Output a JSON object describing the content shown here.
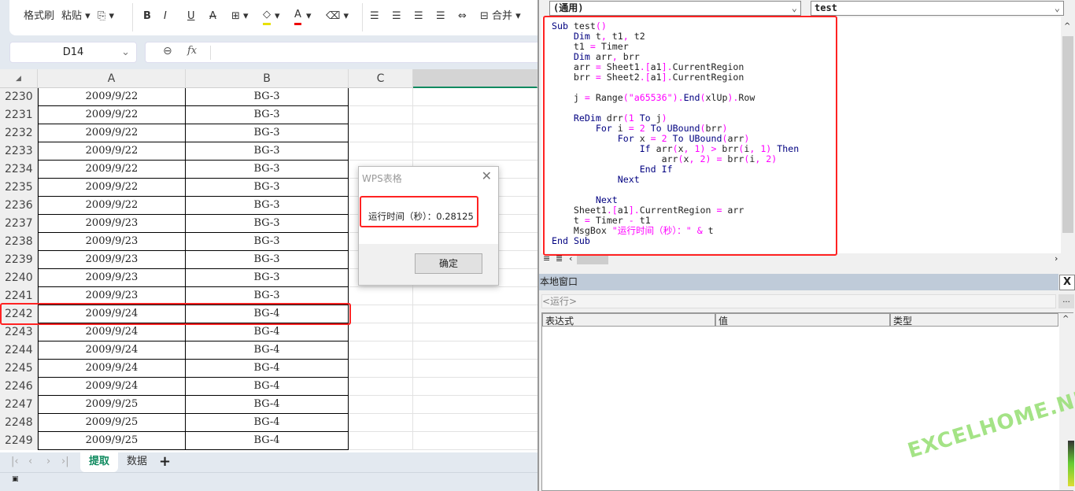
{
  "ribbon": {
    "format_painter": "格式刷",
    "paste": "粘贴",
    "merge": "合并"
  },
  "formula_bar": {
    "name_box": "D14",
    "fx": "fx",
    "value": ""
  },
  "columns": [
    "A",
    "B",
    "C"
  ],
  "rows": [
    {
      "n": "2230",
      "a": "2009/9/22",
      "b": "BG-3"
    },
    {
      "n": "2231",
      "a": "2009/9/22",
      "b": "BG-3"
    },
    {
      "n": "2232",
      "a": "2009/9/22",
      "b": "BG-3"
    },
    {
      "n": "2233",
      "a": "2009/9/22",
      "b": "BG-3"
    },
    {
      "n": "2234",
      "a": "2009/9/22",
      "b": "BG-3"
    },
    {
      "n": "2235",
      "a": "2009/9/22",
      "b": "BG-3"
    },
    {
      "n": "2236",
      "a": "2009/9/22",
      "b": "BG-3"
    },
    {
      "n": "2237",
      "a": "2009/9/23",
      "b": "BG-3"
    },
    {
      "n": "2238",
      "a": "2009/9/23",
      "b": "BG-3"
    },
    {
      "n": "2239",
      "a": "2009/9/23",
      "b": "BG-3"
    },
    {
      "n": "2240",
      "a": "2009/9/23",
      "b": "BG-3"
    },
    {
      "n": "2241",
      "a": "2009/9/23",
      "b": "BG-3"
    },
    {
      "n": "2242",
      "a": "2009/9/24",
      "b": "BG-4"
    },
    {
      "n": "2243",
      "a": "2009/9/24",
      "b": "BG-4"
    },
    {
      "n": "2244",
      "a": "2009/9/24",
      "b": "BG-4"
    },
    {
      "n": "2245",
      "a": "2009/9/24",
      "b": "BG-4"
    },
    {
      "n": "2246",
      "a": "2009/9/24",
      "b": "BG-4"
    },
    {
      "n": "2247",
      "a": "2009/9/25",
      "b": "BG-4"
    },
    {
      "n": "2248",
      "a": "2009/9/25",
      "b": "BG-4"
    },
    {
      "n": "2249",
      "a": "2009/9/25",
      "b": "BG-4"
    }
  ],
  "sheet_tabs": [
    {
      "label": "提取",
      "active": true
    },
    {
      "label": "数据",
      "active": false
    }
  ],
  "dialog": {
    "title": "WPS表格",
    "message": "运行时间（秒）：0.28125",
    "ok": "确定"
  },
  "vba": {
    "object_combo": "(通用)",
    "proc_combo": "test",
    "code": [
      "Sub test()",
      "    Dim t, t1, t2",
      "    t1 = Timer",
      "    Dim arr, brr",
      "    arr = Sheet1.[a1].CurrentRegion",
      "    brr = Sheet2.[a1].CurrentRegion",
      "",
      "    j = Range(\"a65536\").End(xlUp).Row",
      "",
      "    ReDim drr(1 To j)",
      "        For i = 2 To UBound(brr)",
      "            For x = 2 To UBound(arr)",
      "                If arr(x, 1) > brr(i, 1) Then",
      "                    arr(x, 2) = brr(i, 2)",
      "                End If",
      "            Next",
      "",
      "        Next",
      "    Sheet1.[a1].CurrentRegion = arr",
      "    t = Timer - t1",
      "    MsgBox \"运行时间（秒）：\" & t",
      "End Sub"
    ],
    "locals": {
      "title": "本地窗口",
      "context": "<运行>",
      "columns": [
        "表达式",
        "值",
        "类型"
      ]
    }
  },
  "watermark": "EXCELHOME.NET",
  "colors": {
    "accent": "#0f8a5f",
    "highlight": "#ff2222",
    "keyword": "#000080",
    "operator": "#ff00ff"
  }
}
